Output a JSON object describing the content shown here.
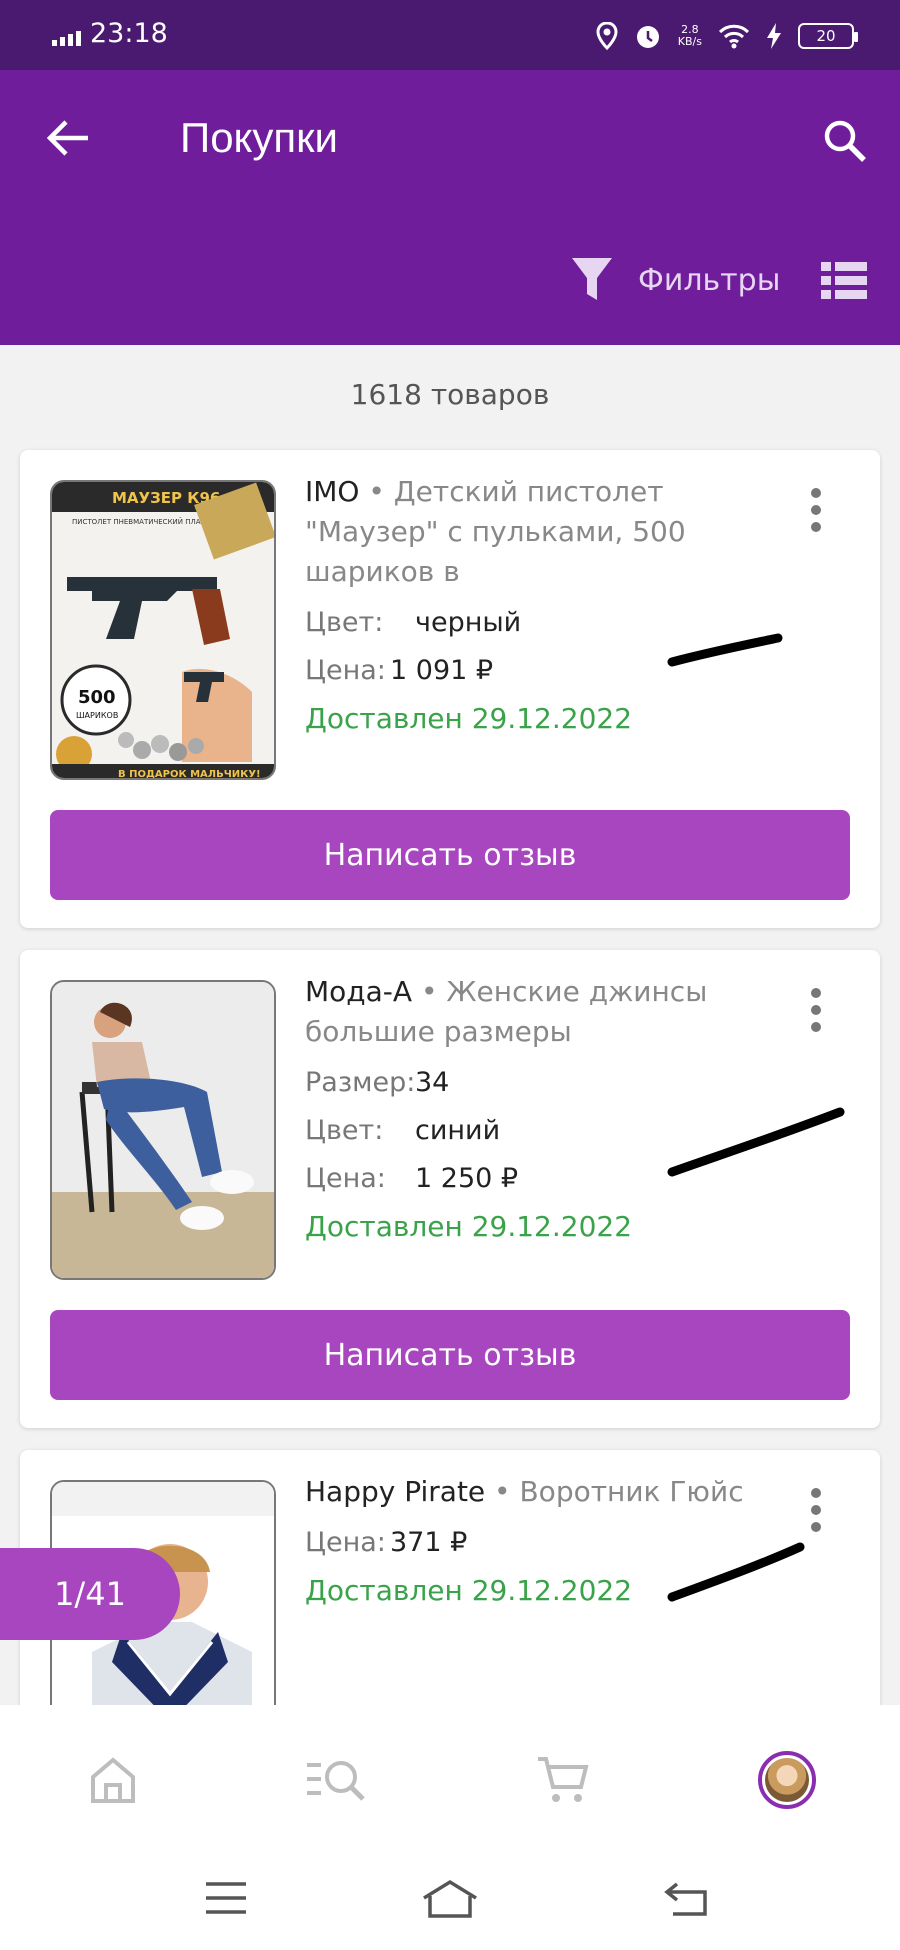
{
  "status_bar": {
    "time": "23:18",
    "net_speed_value": "2.8",
    "net_speed_unit": "KB/s",
    "battery": "20"
  },
  "header": {
    "title": "Покупки",
    "filters_label": "Фильтры"
  },
  "summary": {
    "count_text": "1618 товаров"
  },
  "labels": {
    "color": "Цвет:",
    "price": "Цена:",
    "size": "Размер:",
    "review_button": "Написать отзыв"
  },
  "products": [
    {
      "brand": "IMO",
      "title": " • Детский пистолет \"Маузер\" с пульками, 500 шариков в",
      "color": "черный",
      "price": "1 091 ₽",
      "status": "Доставлен 29.12.2022",
      "image_text": {
        "banner": "МАУЗЕР К96",
        "sub": "ПИСТОЛЕТ ПНЕВМАТИЧЕСКИЙ ПЛАСТИК+МЕТАЛЛ",
        "badge_num": "500",
        "badge_word": "ШАРИКОВ",
        "bottom": "В ПОДАРОК МАЛЬЧИКУ!"
      }
    },
    {
      "brand": "Мода-А",
      "title": " • Женские джинсы большие размеры",
      "size": "34",
      "color": "синий",
      "price": "1 250 ₽",
      "status": "Доставлен 29.12.2022"
    },
    {
      "brand": "Happy Pirate",
      "title": " • Воротник Гюйс",
      "price": "371 ₽",
      "status": "Доставлен 29.12.2022"
    }
  ],
  "pager": {
    "text": "1/41"
  },
  "colors": {
    "status_bar": "#4a1a70",
    "app_bar": "#6f1d9b",
    "accent": "#a846bf",
    "delivered": "#3aa34a"
  }
}
